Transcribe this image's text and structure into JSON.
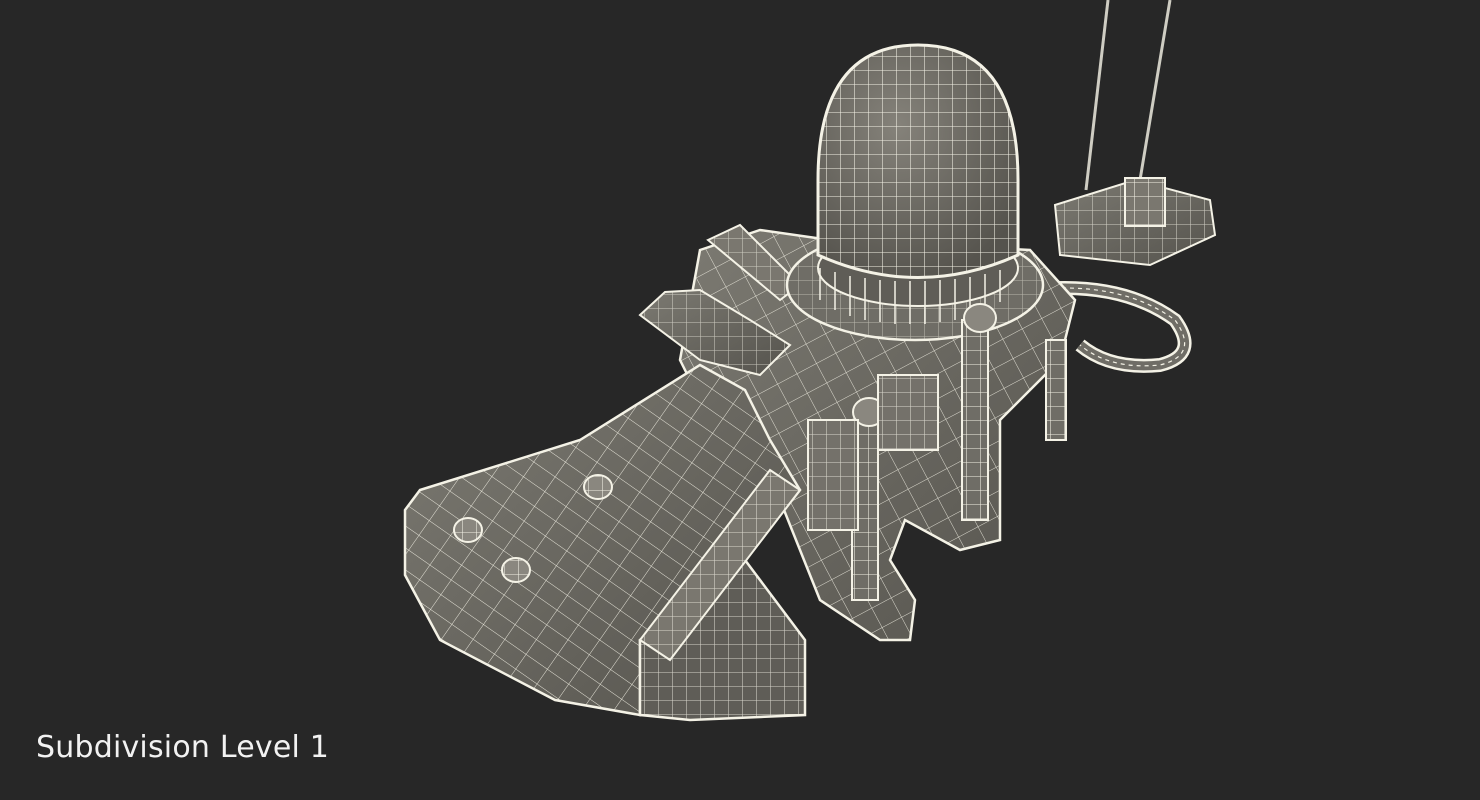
{
  "viewport": {
    "background": "#272727",
    "model_fill": "#6f6d66",
    "wire_color": "#f4f2e6"
  },
  "caption": {
    "text": "Subdivision Level 1"
  }
}
